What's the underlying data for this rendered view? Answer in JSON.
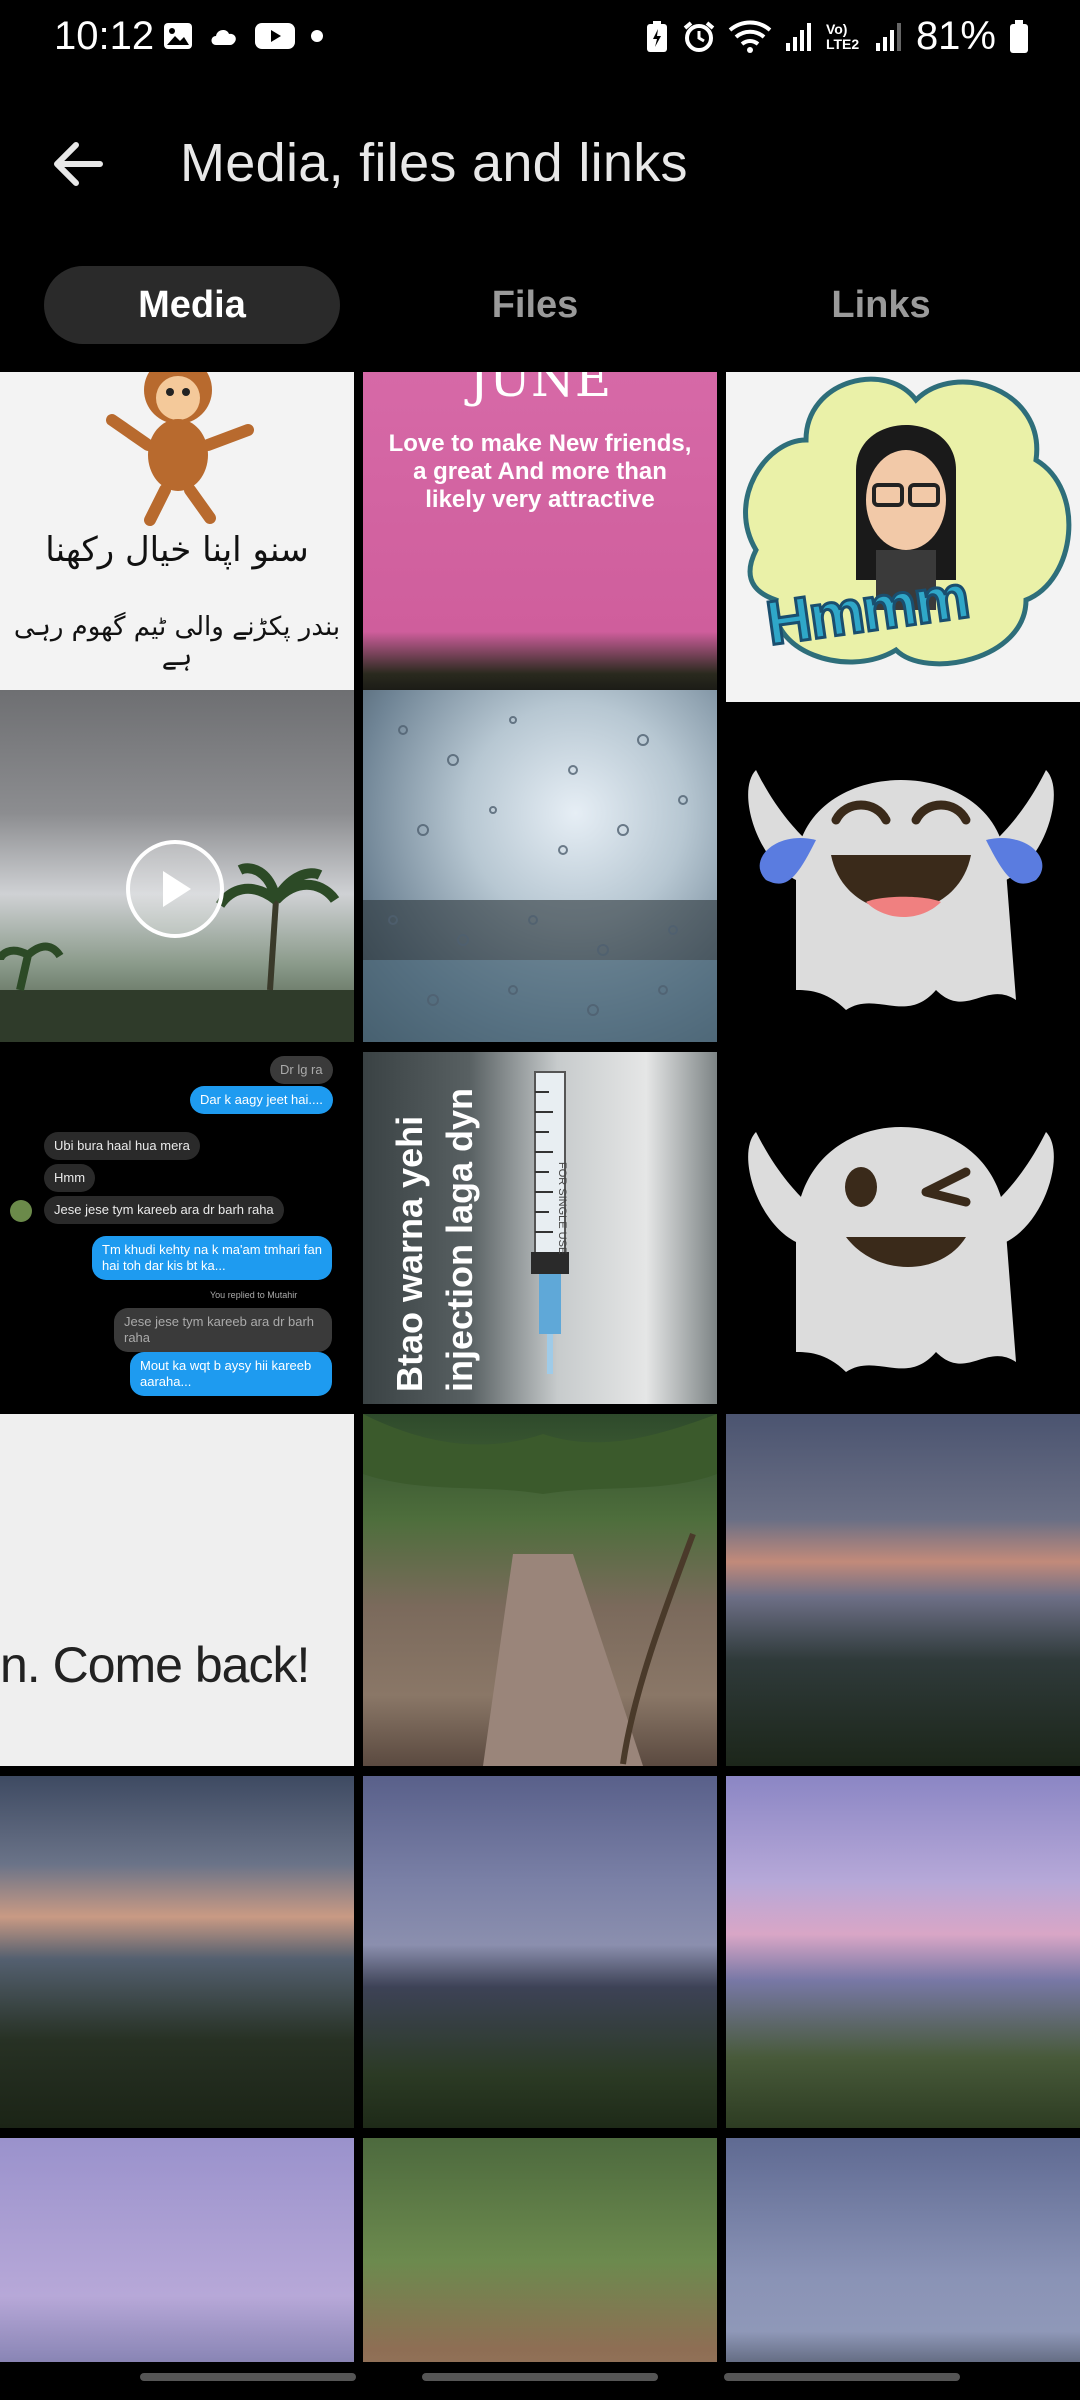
{
  "status_bar": {
    "time": "10:12",
    "battery": "81%",
    "network_label": "Vo) LTE2"
  },
  "header": {
    "title": "Media, files and links",
    "back_icon": "arrow-left-icon"
  },
  "tabs": [
    {
      "label": "Media",
      "active": true
    },
    {
      "label": "Files",
      "active": false
    },
    {
      "label": "Links",
      "active": false
    }
  ],
  "media": {
    "monkey_urdu_line1": "سنو اپنا خیال رکھنا",
    "monkey_urdu_line2": "بندر پکڑنے والی ٹیم گھوم رہی ہے",
    "june_title": "JUNE",
    "june_body": "Love to make New friends, a great And more than likely very attractive",
    "hmm_sticker": "Hmmm",
    "syringe_text_1": "Btao warna yehi",
    "syringe_text_2": "injection laga dyn",
    "syringe_label": "FOR SINGLE USE",
    "come_back_text": "n. Come back!",
    "chat": [
      {
        "text": "Dr lg ra",
        "from": "dim"
      },
      {
        "text": "Dar k aagy jeet hai....",
        "from": "me"
      },
      {
        "text": "Ubi bura haal hua mera",
        "from": "them"
      },
      {
        "text": "Hmm",
        "from": "them"
      },
      {
        "text": "Jese jese tym kareeb ara dr barh raha",
        "from": "them"
      },
      {
        "text": "Tm khudi kehty na k ma'am tmhari fan hai toh dar kis bt ka...",
        "from": "me"
      },
      {
        "text": "You replied to Mutahir",
        "from": "note"
      },
      {
        "text": "Jese jese tym kareeb ara dr barh raha",
        "from": "dim"
      },
      {
        "text": "Mout ka wqt b aysy hii kareeb aaraha...",
        "from": "me"
      }
    ]
  },
  "colors": {
    "background": "#000000",
    "tab_active_bg": "#2a2a2a",
    "tab_inactive_text": "#9a9a9a",
    "chat_me": "#1e9bf0"
  }
}
